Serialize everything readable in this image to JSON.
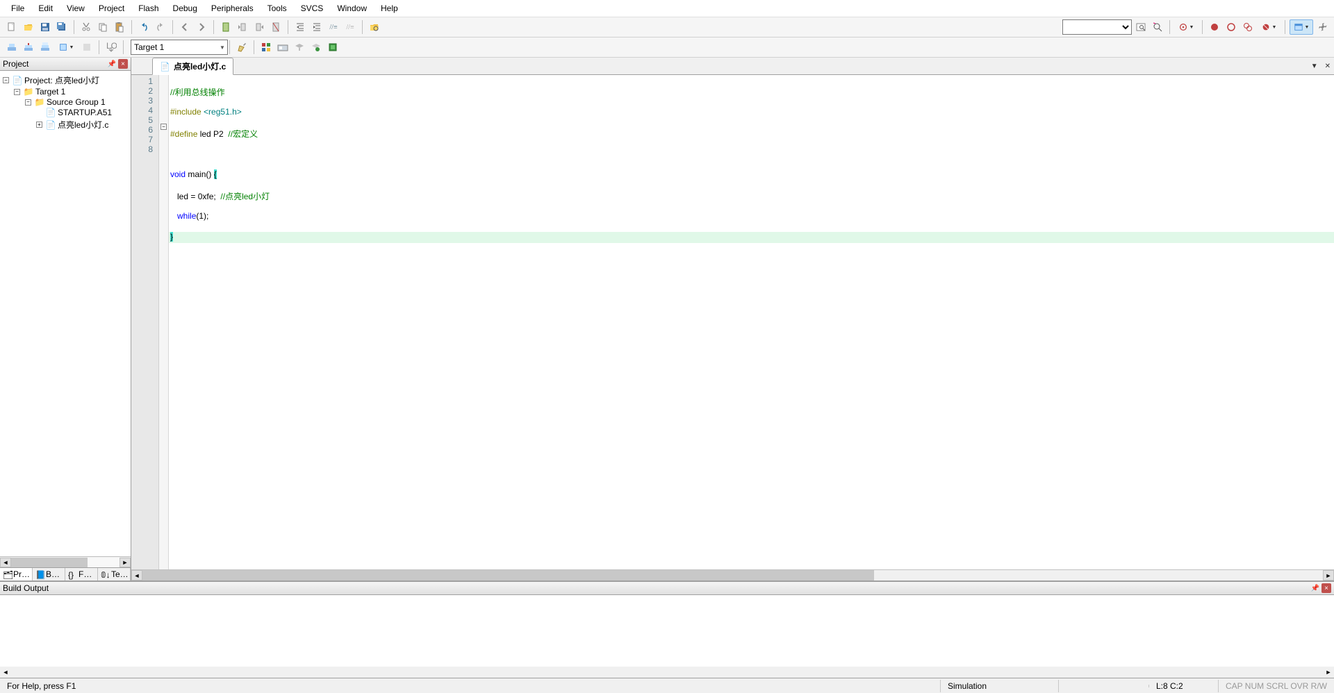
{
  "menu": [
    "File",
    "Edit",
    "View",
    "Project",
    "Flash",
    "Debug",
    "Peripherals",
    "Tools",
    "SVCS",
    "Window",
    "Help"
  ],
  "project_panel": {
    "title": "Project",
    "root": "Project: 点亮led小灯",
    "target": "Target 1",
    "group": "Source Group 1",
    "files": [
      "STARTUP.A51",
      "点亮led小灯.c"
    ],
    "tabs": [
      "Pr…",
      "B…",
      "F…",
      "Te…"
    ]
  },
  "target_select": "Target 1",
  "editor": {
    "tab_name": "点亮led小灯.c",
    "line_count": 8
  },
  "code": {
    "l1_comment": "//利用总线操作",
    "l2_pp": "#include ",
    "l2_str": "<reg51.h>",
    "l3_pp": "#define ",
    "l3_id": "led P2  ",
    "l3_comment": "//宏定义",
    "indent": "   ",
    "l5_kw": "void ",
    "l5_id": "main() ",
    "l5_brace": "{",
    "l6_id": "led = ",
    "l6_num": "0xfe",
    "l6_id2": ";  ",
    "l6_comment": "//点亮led小灯",
    "l7_kw": "while",
    "l7_rest": "(1);",
    "l8_brace": "}"
  },
  "build_output": {
    "title": "Build Output"
  },
  "status": {
    "help": "For Help, press F1",
    "mode": "Simulation",
    "pos": "L:8 C:2",
    "indicators": "CAP  NUM  SCRL  OVR  R/W"
  }
}
